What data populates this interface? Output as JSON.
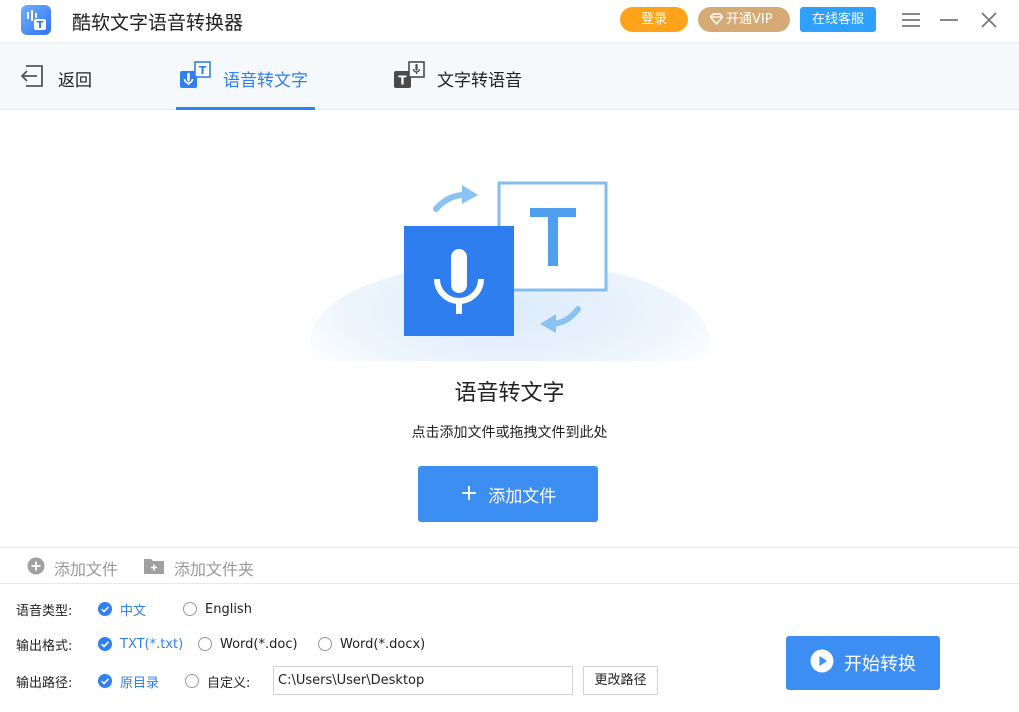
{
  "app": {
    "title": "酷软文字语音转换器"
  },
  "titlebar": {
    "login_label": "登录",
    "vip_label": "开通VIP",
    "service_label": "在线客服"
  },
  "tabs": {
    "back_label": "返回",
    "items": [
      {
        "label": "语音转文字",
        "active": true
      },
      {
        "label": "文字转语音",
        "active": false
      }
    ]
  },
  "dropzone": {
    "title": "语音转文字",
    "hint": "点击添加文件或拖拽文件到此处",
    "add_button_label": "添加文件"
  },
  "filebar": {
    "add_file_label": "添加文件",
    "add_folder_label": "添加文件夹"
  },
  "settings": {
    "language": {
      "label": "语音类型:",
      "options": [
        "中文",
        "English"
      ],
      "selected": "中文"
    },
    "format": {
      "label": "输出格式:",
      "options": [
        "TXT(*.txt)",
        "Word(*.doc)",
        "Word(*.docx)"
      ],
      "selected": "TXT(*.txt)"
    },
    "path": {
      "label": "输出路径:",
      "options": [
        "原目录",
        "自定义:"
      ],
      "selected": "原目录",
      "value": "C:\\Users\\User\\Desktop",
      "change_label": "更改路径"
    },
    "start_label": "开始转换"
  },
  "colors": {
    "accent": "#2f80f0",
    "button_blue": "#3d8ef2",
    "login_orange": "#ffa31a",
    "vip_gold": "#d6aa74",
    "service_blue": "#2fa0ff"
  }
}
